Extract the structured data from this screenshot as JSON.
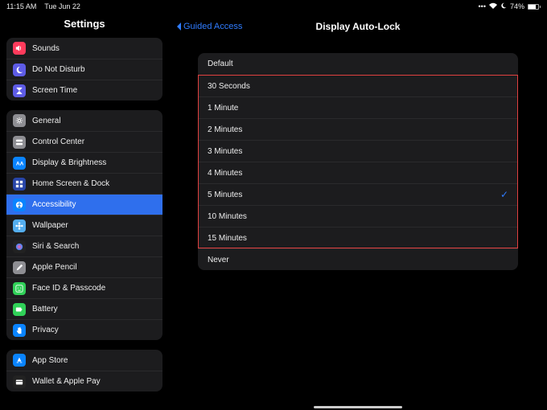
{
  "status": {
    "time": "11:15 AM",
    "date": "Tue Jun 22",
    "battery": "74%"
  },
  "sidebar": {
    "title": "Settings",
    "groups": [
      [
        {
          "label": "Sounds",
          "icon": "speaker-icon",
          "bg": "#ff3b5c"
        },
        {
          "label": "Do Not Disturb",
          "icon": "moon-icon",
          "bg": "#5e5ce6"
        },
        {
          "label": "Screen Time",
          "icon": "hourglass-icon",
          "bg": "#5e5ce6"
        }
      ],
      [
        {
          "label": "General",
          "icon": "gear-icon",
          "bg": "#8e8e93"
        },
        {
          "label": "Control Center",
          "icon": "switches-icon",
          "bg": "#8e8e93"
        },
        {
          "label": "Display & Brightness",
          "icon": "text-size-icon",
          "bg": "#0a84ff"
        },
        {
          "label": "Home Screen & Dock",
          "icon": "grid-icon",
          "bg": "#2845a8"
        },
        {
          "label": "Accessibility",
          "icon": "accessibility-icon",
          "bg": "#0a84ff",
          "selected": true
        },
        {
          "label": "Wallpaper",
          "icon": "flower-icon",
          "bg": "#54aeef"
        },
        {
          "label": "Siri & Search",
          "icon": "siri-icon",
          "bg": "#222"
        },
        {
          "label": "Apple Pencil",
          "icon": "pencil-icon",
          "bg": "#8e8e93"
        },
        {
          "label": "Face ID & Passcode",
          "icon": "faceid-icon",
          "bg": "#30d158"
        },
        {
          "label": "Battery",
          "icon": "battery-icon",
          "bg": "#30d158"
        },
        {
          "label": "Privacy",
          "icon": "hand-icon",
          "bg": "#0a84ff"
        }
      ],
      [
        {
          "label": "App Store",
          "icon": "appstore-icon",
          "bg": "#0a84ff"
        },
        {
          "label": "Wallet & Apple Pay",
          "icon": "wallet-icon",
          "bg": "#222"
        }
      ]
    ]
  },
  "content": {
    "back": "Guided Access",
    "title": "Display Auto-Lock",
    "options": [
      {
        "label": "Default"
      },
      {
        "label": "30 Seconds"
      },
      {
        "label": "1 Minute"
      },
      {
        "label": "2 Minutes"
      },
      {
        "label": "3 Minutes"
      },
      {
        "label": "4 Minutes"
      },
      {
        "label": "5 Minutes",
        "checked": true
      },
      {
        "label": "10 Minutes"
      },
      {
        "label": "15 Minutes"
      },
      {
        "label": "Never"
      }
    ],
    "highlight": {
      "start": 1,
      "end": 8
    }
  },
  "icons": {
    "speaker-icon": "<path fill='white' d='M1 4h2l3-2v8l-3-2H1z'/><path stroke='white' fill='none' d='M7 3c1 1 1 5 0 6'/>",
    "moon-icon": "<path fill='white' d='M7 1a5 5 0 1 0 4 8 4 4 0 0 1-4-8z'/>",
    "hourglass-icon": "<path fill='white' d='M2 1h8v1L6 6l4 4v1H2v-1l4-4L2 2z'/>",
    "gear-icon": "<circle cx='6' cy='6' r='2' fill='none' stroke='white'/><path stroke='white' d='M6 1v2M6 9v2M1 6h2M9 6h2M2.5 2.5l1.4 1.4M8.1 8.1l1.4 1.4M2.5 9.5l1.4-1.4M8.1 3.9l1.4-1.4'/>",
    "switches-icon": "<rect x='1' y='2' width='10' height='3' rx='1.5' fill='white'/><rect x='1' y='7' width='10' height='3' rx='1.5' fill='white'/>",
    "text-size-icon": "<text x='1' y='9' font-size='8' fill='white' font-weight='bold'>AA</text>",
    "grid-icon": "<rect x='1' y='1' width='4' height='4' fill='white'/><rect x='7' y='1' width='4' height='4' fill='white'/><rect x='1' y='7' width='4' height='4' fill='white'/><rect x='7' y='7' width='4' height='4' fill='white'/>",
    "accessibility-icon": "<circle cx='6' cy='6' r='5' fill='white'/><circle cx='6' cy='3' r='1' fill='#0a84ff'/><path stroke='#0a84ff' d='M3 5h6M6 5v3M4 10l2-2 2 2'/>",
    "flower-icon": "<circle cx='6' cy='6' r='2' fill='white'/><circle cx='6' cy='2' r='1.5' fill='white'/><circle cx='6' cy='10' r='1.5' fill='white'/><circle cx='2' cy='6' r='1.5' fill='white'/><circle cx='10' cy='6' r='1.5' fill='white'/>",
    "siri-icon": "<circle cx='6' cy='6' r='5' fill='url(#g)'/><defs><radialGradient id='g'><stop offset='0' stop-color='#ff5ea0'/><stop offset='1' stop-color='#3a8bff'/></radialGradient></defs>",
    "pencil-icon": "<path fill='white' d='M2 10l1-3 6-6 2 2-6 6z'/>",
    "faceid-icon": "<rect x='1' y='1' width='10' height='10' rx='2' fill='none' stroke='white'/><circle cx='4' cy='5' r='.7' fill='white'/><circle cx='8' cy='5' r='.7' fill='white'/><path stroke='white' fill='none' d='M4 8c1 1 3 1 4 0'/>",
    "battery-icon": "<rect x='1' y='3' width='8' height='6' rx='1' fill='white'/><rect x='9' y='5' width='1' height='2' fill='white'/>",
    "hand-icon": "<path fill='white' d='M4 2v5l-1-1-1 1 3 4h4V4l-1-1v3-4l-1-1v4-3l-1-1v4-3z'/>",
    "appstore-icon": "<path fill='white' d='M6 2l3 6H3z'/><rect x='2' y='9' width='3' height='1' fill='white'/><rect x='7' y='9' width='3' height='1' fill='white'/>",
    "wallet-icon": "<rect x='1' y='3' width='10' height='7' rx='1' fill='white'/><rect x='1' y='5' width='10' height='1' fill='#333'/>"
  }
}
